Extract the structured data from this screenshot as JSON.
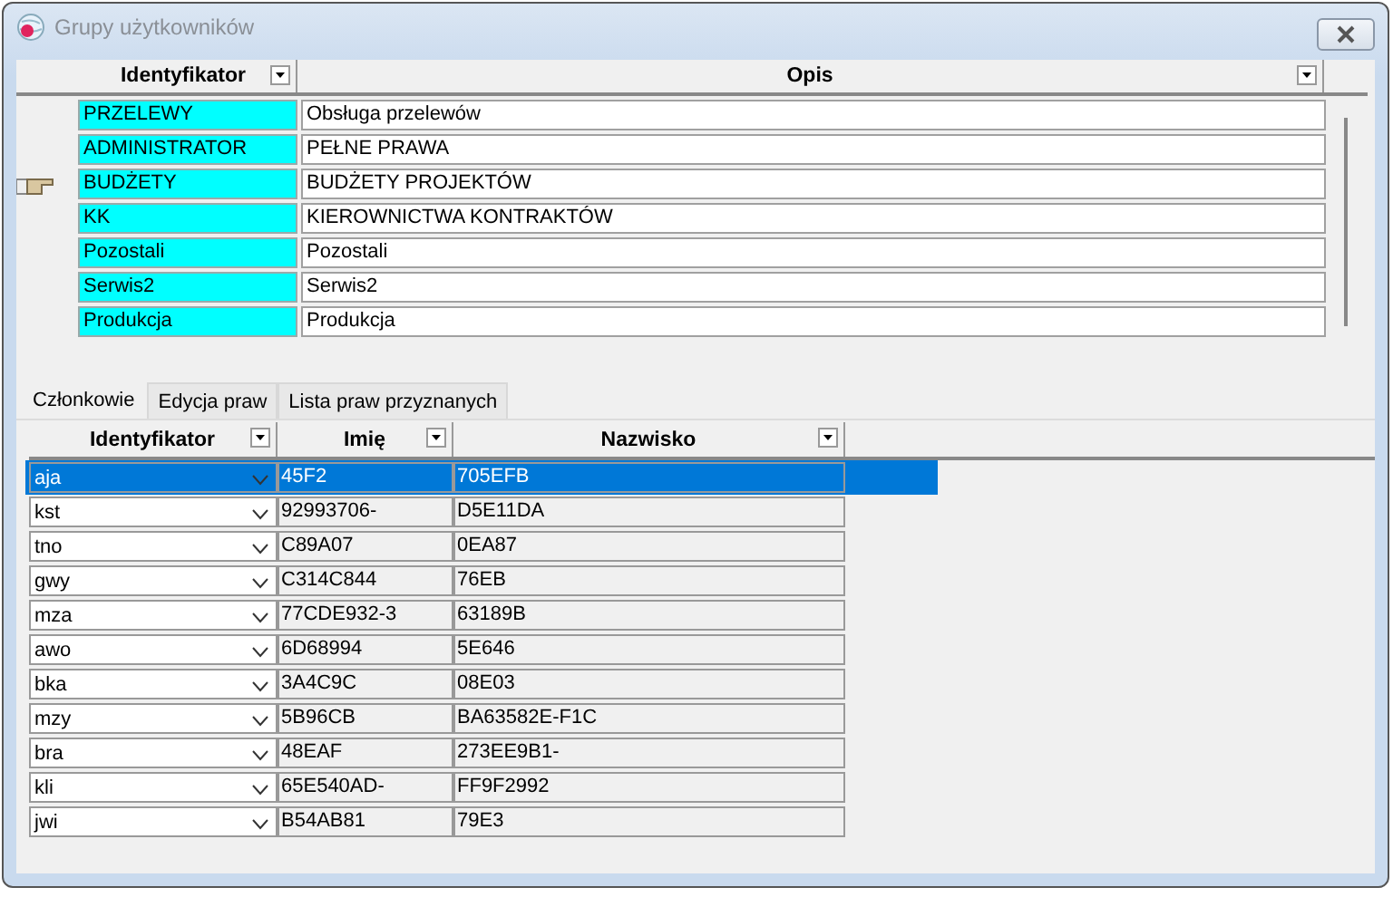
{
  "window": {
    "title": "Grupy użytkowników"
  },
  "groups_table": {
    "columns": [
      "Identyfikator",
      "Opis"
    ],
    "rows": [
      {
        "id": "PRZELEWY",
        "description": "Obsługa przelewów",
        "selected": false
      },
      {
        "id": "ADMINISTRATOR",
        "description": "PEŁNE PRAWA",
        "selected": false
      },
      {
        "id": "BUDŻETY",
        "description": "BUDŻETY PROJEKTÓW",
        "selected": true
      },
      {
        "id": "KK",
        "description": "KIEROWNICTWA KONTRAKTÓW",
        "selected": false
      },
      {
        "id": "Pozostali",
        "description": "Pozostali",
        "selected": false
      },
      {
        "id": "Serwis2",
        "description": "Serwis2",
        "selected": false
      },
      {
        "id": "Produkcja",
        "description": "Produkcja",
        "selected": false
      }
    ]
  },
  "tabs": [
    {
      "label": "Członkowie",
      "selected": true
    },
    {
      "label": "Edycja praw",
      "selected": false
    },
    {
      "label": "Lista praw przyznanych",
      "selected": false
    }
  ],
  "members_table": {
    "columns": [
      "Identyfikator",
      "Imię",
      "Nazwisko"
    ],
    "rows": [
      {
        "id": "aja",
        "first_name": "45F2",
        "last_name": "705EFB",
        "selected": true
      },
      {
        "id": "kst",
        "first_name": "92993706-",
        "last_name": "D5E11DA",
        "selected": false
      },
      {
        "id": "tno",
        "first_name": "C89A07",
        "last_name": "0EA87",
        "selected": false
      },
      {
        "id": "gwy",
        "first_name": "C314C844",
        "last_name": "76EB",
        "selected": false
      },
      {
        "id": "mza",
        "first_name": "77CDE932-3",
        "last_name": "63189B",
        "selected": false
      },
      {
        "id": "awo",
        "first_name": "6D68994",
        "last_name": "5E646",
        "selected": false
      },
      {
        "id": "bka",
        "first_name": "3A4C9C",
        "last_name": "08E03",
        "selected": false
      },
      {
        "id": "mzy",
        "first_name": "5B96CB",
        "last_name": "BA63582E-F1C",
        "selected": false
      },
      {
        "id": "bra",
        "first_name": "48EAF",
        "last_name": "273EE9B1-",
        "selected": false
      },
      {
        "id": "kli",
        "first_name": "65E540AD-",
        "last_name": "FF9F2992",
        "selected": false
      },
      {
        "id": "jwi",
        "first_name": "B54AB81",
        "last_name": "79E3",
        "selected": false
      }
    ]
  }
}
